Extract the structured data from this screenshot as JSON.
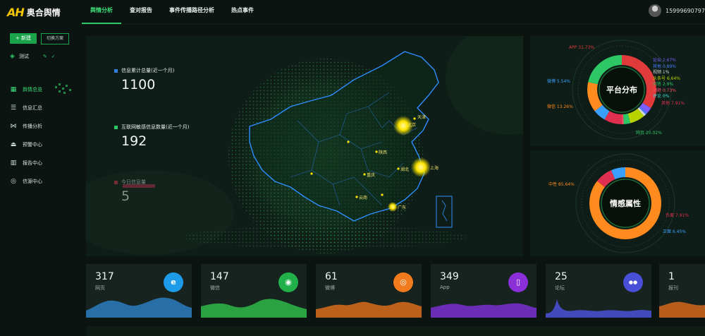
{
  "logo": {
    "mark": "AH",
    "name": "奥合舆情"
  },
  "nav": [
    {
      "label": "舆情分析",
      "active": true
    },
    {
      "label": "查对报告",
      "active": false
    },
    {
      "label": "事件传播路径分析",
      "active": false
    },
    {
      "label": "热点事件",
      "active": false
    }
  ],
  "user": {
    "phone": "15999690797"
  },
  "sidebar": {
    "new_button": "+ 新建",
    "plan_button": "切换方案",
    "scheme_name": "测试",
    "items": [
      {
        "label": "舆情总览",
        "icon": "grid-icon",
        "active": true
      },
      {
        "label": "信息汇总",
        "icon": "list-icon",
        "active": false
      },
      {
        "label": "传播分析",
        "icon": "share-icon",
        "active": false
      },
      {
        "label": "预警中心",
        "icon": "alarm-icon",
        "active": false
      },
      {
        "label": "报告中心",
        "icon": "report-icon",
        "active": false
      },
      {
        "label": "信源中心",
        "icon": "target-icon",
        "active": false
      }
    ]
  },
  "stats": [
    {
      "label": "信息累计总量(近一个月)",
      "value": "1100",
      "color": "#2f7fe0"
    },
    {
      "label": "互联网敏感信息数量(近一个月)",
      "value": "192",
      "color": "#2dc766"
    },
    {
      "label": "今日信息量",
      "value": "5",
      "color": "#e0304f"
    }
  ],
  "map": {
    "cities": [
      "北京",
      "天津",
      "上海",
      "陕西",
      "重庆",
      "湖北",
      "云南",
      "广东"
    ]
  },
  "platform": {
    "title": "平台分布",
    "labels": [
      {
        "text": "APP 31.73%",
        "color": "#e03a3a"
      },
      {
        "text": "论坛 2.67%",
        "color": "#7a5cff"
      },
      {
        "text": "其他 0.89%",
        "color": "#4a7dff"
      },
      {
        "text": "视频 1%",
        "color": "#d8d8d8"
      },
      {
        "text": "头条号 6.64%",
        "color": "#b8d400"
      },
      {
        "text": "问答 2.9%",
        "color": "#2dc766"
      },
      {
        "text": "问题 0.73%",
        "color": "#ff4f6a"
      },
      {
        "text": "评论 0%",
        "color": "#46e0e0"
      },
      {
        "text": "其他 7.91%",
        "color": "#e0304f"
      },
      {
        "text": "微博 5.54%",
        "color": "#3aa0ff"
      },
      {
        "text": "微信 13.26%",
        "color": "#ff8a1e"
      },
      {
        "text": "网页 20.02%",
        "color": "#2dc766"
      }
    ]
  },
  "sentiment": {
    "title": "情感属性",
    "labels": [
      {
        "text": "中性 85.64%",
        "color": "#ff8a1e"
      },
      {
        "text": "负面 7.91%",
        "color": "#e0304f"
      },
      {
        "text": "正面 6.45%",
        "color": "#3aa0ff"
      }
    ]
  },
  "cards": [
    {
      "value": "317",
      "label": "网页",
      "icon": "ie-icon",
      "glyph": "e",
      "icon_color": "#1e9be8",
      "wave_color": "#2b7bbf"
    },
    {
      "value": "147",
      "label": "微信",
      "icon": "wechat-icon",
      "glyph": "◉",
      "icon_color": "#22b04a",
      "wave_color": "#2fb848"
    },
    {
      "value": "61",
      "label": "微博",
      "icon": "weibo-icon",
      "glyph": "◎",
      "icon_color": "#f07a1c",
      "wave_color": "#d96c1c"
    },
    {
      "value": "349",
      "label": "App",
      "icon": "phone-icon",
      "glyph": "▯",
      "icon_color": "#8b2fd8",
      "wave_color": "#7a2fd0"
    },
    {
      "value": "25",
      "label": "论坛",
      "icon": "users-icon",
      "glyph": "●●",
      "icon_color": "#4a4fd8",
      "wave_color": "#4a52d8"
    },
    {
      "value": "1",
      "label": "报刊",
      "icon": "newspaper-icon",
      "glyph": "▤",
      "icon_color": "#d9581c",
      "wave_color": "#d2671c"
    }
  ]
}
